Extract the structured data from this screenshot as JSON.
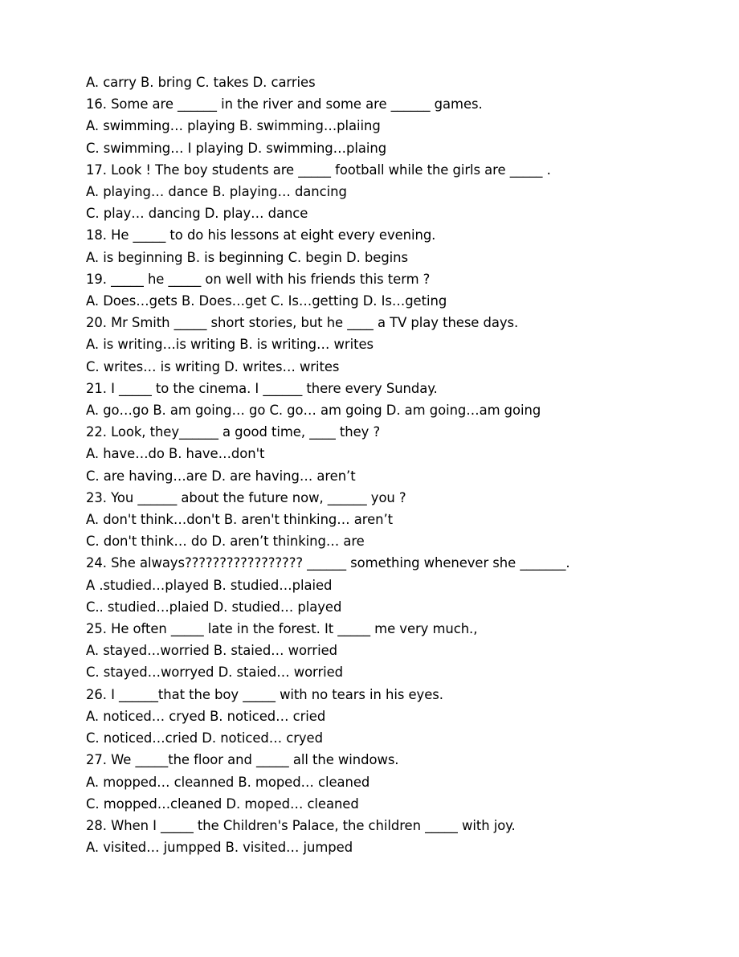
{
  "document": {
    "type": "english-grammar-multiple-choice-worksheet",
    "page_background": "#ffffff",
    "text_color": "#000000",
    "lines": [
      "A. carry B. bring C. takes D. carries",
      "16. Some are ______ in the river and some are ______ games.",
      "A. swimming… playing B. swimming…plaiing",
      "C. swimming… I playing D. swimming…plaing",
      "17. Look ! The boy students are _____ football while the girls are _____ .",
      "A. playing… dance B. playing… dancing",
      "C. play… dancing D. play… dance",
      "18. He _____ to do his lessons at eight every evening.",
      "A. is beginning B. is beginning C. begin D. begins",
      "19. _____ he _____ on well with his friends this term ?",
      "A. Does…gets B. Does…get C. Is…getting D. Is…geting",
      "20. Mr Smith _____ short stories, but he ____ a TV play these days.",
      "A. is writing…is writing B. is writing… writes",
      "C. writes… is writing D. writes… writes",
      "21. I _____ to the cinema. I ______ there every Sunday.",
      "A. go…go B. am going… go C. go… am going D. am going…am going",
      "22. Look, they______ a good time, ____ they ?",
      "A. have…do B. have…don't",
      "C. are having…are D. are having… aren’t",
      "23. You ______ about the future now, ______ you ?",
      "A. don't think…don't B. aren't thinking… aren’t",
      "C. don't think… do D. aren’t thinking… are",
      "24. She always????????????????? ______ something whenever she _______.",
      "A .studied…played B. studied…plaied",
      "C.. studied…plaied D. studied… played",
      "25. He often _____ late in the forest. It _____ me very much.,",
      "A. stayed…worried B. staied… worried",
      "C. stayed…worryed D. staied… worried",
      "26. I ______that the boy _____ with no tears in his eyes.",
      "A. noticed… cryed B. noticed… cried",
      "C. noticed…cried D. noticed… cryed",
      "27. We _____the floor and _____ all the windows.",
      "A. mopped… cleanned B. moped… cleaned",
      "C. mopped…cleaned D. moped… cleaned",
      "28. When I _____ the Children's Palace, the children _____ with joy.",
      "A. visited… jumpped B. visited… jumped"
    ]
  }
}
